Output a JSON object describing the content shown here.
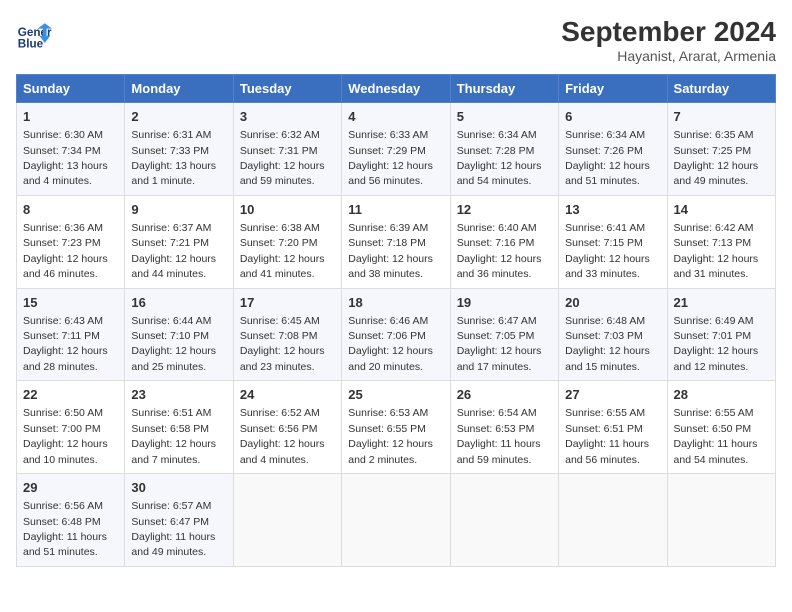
{
  "header": {
    "logo_line1": "General",
    "logo_line2": "Blue",
    "title": "September 2024",
    "subtitle": "Hayanist, Ararat, Armenia"
  },
  "calendar": {
    "days_of_week": [
      "Sunday",
      "Monday",
      "Tuesday",
      "Wednesday",
      "Thursday",
      "Friday",
      "Saturday"
    ],
    "weeks": [
      [
        {
          "day": "1",
          "sunrise": "6:30 AM",
          "sunset": "7:34 PM",
          "daylight": "13 hours and 4 minutes"
        },
        {
          "day": "2",
          "sunrise": "6:31 AM",
          "sunset": "7:33 PM",
          "daylight": "13 hours and 1 minute"
        },
        {
          "day": "3",
          "sunrise": "6:32 AM",
          "sunset": "7:31 PM",
          "daylight": "12 hours and 59 minutes"
        },
        {
          "day": "4",
          "sunrise": "6:33 AM",
          "sunset": "7:29 PM",
          "daylight": "12 hours and 56 minutes"
        },
        {
          "day": "5",
          "sunrise": "6:34 AM",
          "sunset": "7:28 PM",
          "daylight": "12 hours and 54 minutes"
        },
        {
          "day": "6",
          "sunrise": "6:34 AM",
          "sunset": "7:26 PM",
          "daylight": "12 hours and 51 minutes"
        },
        {
          "day": "7",
          "sunrise": "6:35 AM",
          "sunset": "7:25 PM",
          "daylight": "12 hours and 49 minutes"
        }
      ],
      [
        {
          "day": "8",
          "sunrise": "6:36 AM",
          "sunset": "7:23 PM",
          "daylight": "12 hours and 46 minutes"
        },
        {
          "day": "9",
          "sunrise": "6:37 AM",
          "sunset": "7:21 PM",
          "daylight": "12 hours and 44 minutes"
        },
        {
          "day": "10",
          "sunrise": "6:38 AM",
          "sunset": "7:20 PM",
          "daylight": "12 hours and 41 minutes"
        },
        {
          "day": "11",
          "sunrise": "6:39 AM",
          "sunset": "7:18 PM",
          "daylight": "12 hours and 38 minutes"
        },
        {
          "day": "12",
          "sunrise": "6:40 AM",
          "sunset": "7:16 PM",
          "daylight": "12 hours and 36 minutes"
        },
        {
          "day": "13",
          "sunrise": "6:41 AM",
          "sunset": "7:15 PM",
          "daylight": "12 hours and 33 minutes"
        },
        {
          "day": "14",
          "sunrise": "6:42 AM",
          "sunset": "7:13 PM",
          "daylight": "12 hours and 31 minutes"
        }
      ],
      [
        {
          "day": "15",
          "sunrise": "6:43 AM",
          "sunset": "7:11 PM",
          "daylight": "12 hours and 28 minutes"
        },
        {
          "day": "16",
          "sunrise": "6:44 AM",
          "sunset": "7:10 PM",
          "daylight": "12 hours and 25 minutes"
        },
        {
          "day": "17",
          "sunrise": "6:45 AM",
          "sunset": "7:08 PM",
          "daylight": "12 hours and 23 minutes"
        },
        {
          "day": "18",
          "sunrise": "6:46 AM",
          "sunset": "7:06 PM",
          "daylight": "12 hours and 20 minutes"
        },
        {
          "day": "19",
          "sunrise": "6:47 AM",
          "sunset": "7:05 PM",
          "daylight": "12 hours and 17 minutes"
        },
        {
          "day": "20",
          "sunrise": "6:48 AM",
          "sunset": "7:03 PM",
          "daylight": "12 hours and 15 minutes"
        },
        {
          "day": "21",
          "sunrise": "6:49 AM",
          "sunset": "7:01 PM",
          "daylight": "12 hours and 12 minutes"
        }
      ],
      [
        {
          "day": "22",
          "sunrise": "6:50 AM",
          "sunset": "7:00 PM",
          "daylight": "12 hours and 10 minutes"
        },
        {
          "day": "23",
          "sunrise": "6:51 AM",
          "sunset": "6:58 PM",
          "daylight": "12 hours and 7 minutes"
        },
        {
          "day": "24",
          "sunrise": "6:52 AM",
          "sunset": "6:56 PM",
          "daylight": "12 hours and 4 minutes"
        },
        {
          "day": "25",
          "sunrise": "6:53 AM",
          "sunset": "6:55 PM",
          "daylight": "12 hours and 2 minutes"
        },
        {
          "day": "26",
          "sunrise": "6:54 AM",
          "sunset": "6:53 PM",
          "daylight": "11 hours and 59 minutes"
        },
        {
          "day": "27",
          "sunrise": "6:55 AM",
          "sunset": "6:51 PM",
          "daylight": "11 hours and 56 minutes"
        },
        {
          "day": "28",
          "sunrise": "6:55 AM",
          "sunset": "6:50 PM",
          "daylight": "11 hours and 54 minutes"
        }
      ],
      [
        {
          "day": "29",
          "sunrise": "6:56 AM",
          "sunset": "6:48 PM",
          "daylight": "11 hours and 51 minutes"
        },
        {
          "day": "30",
          "sunrise": "6:57 AM",
          "sunset": "6:47 PM",
          "daylight": "11 hours and 49 minutes"
        },
        null,
        null,
        null,
        null,
        null
      ]
    ]
  }
}
